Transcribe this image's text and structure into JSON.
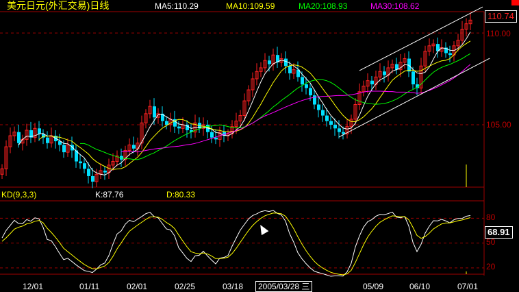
{
  "header": {
    "title": "美元日元(外汇交易)日线",
    "ma5": "MA5:110.29",
    "ma10": "MA10:109.59",
    "ma20": "MA20:108.93",
    "ma30": "MA30:108.62"
  },
  "indicator_header": {
    "name": "KD(9,3,3)",
    "k": "K:87.76",
    "d": "D:80.33"
  },
  "price_axis": {
    "labels": [
      "110.00",
      "105.00"
    ],
    "current": "110.74"
  },
  "kd_axis": {
    "labels": [
      "80",
      "50",
      "20"
    ],
    "current": "68.91"
  },
  "date_axis": {
    "labels": [
      "12/01",
      "01/11",
      "02/01",
      "02/25",
      "03/18",
      "05/09",
      "06/10",
      "07/01"
    ],
    "cursor_date": "2005/03/28 三"
  },
  "colors": {
    "up": "#ff2020",
    "down": "#00e0ff",
    "ma5": "#ffffff",
    "ma10": "#ffff00",
    "ma20": "#00ff00",
    "ma30": "#ff00ff",
    "grid": "#a00000"
  },
  "chart_data": {
    "type": "candlestick",
    "title": "美元日元(外汇交易)日线",
    "ylim": [
      101.6,
      111.16
    ],
    "close": [
      102.6,
      103.8,
      104.4,
      104.6,
      104.0,
      104.2,
      104.7,
      104.3,
      104.8,
      104.5,
      104.3,
      104.0,
      104.4,
      104.1,
      103.9,
      103.5,
      103.9,
      103.6,
      103.0,
      102.9,
      102.6,
      102.2,
      101.9,
      102.3,
      102.5,
      102.4,
      102.8,
      103.0,
      103.3,
      103.1,
      103.6,
      103.9,
      103.7,
      104.0,
      105.1,
      105.6,
      106.0,
      105.4,
      105.6,
      105.2,
      105.0,
      105.3,
      104.9,
      104.8,
      105.0,
      104.7,
      104.6,
      105.1,
      104.8,
      105.0,
      104.6,
      104.3,
      104.2,
      104.6,
      104.4,
      104.5,
      104.9,
      105.2,
      105.5,
      106.3,
      106.9,
      107.5,
      107.9,
      108.1,
      108.5,
      108.3,
      108.8,
      108.4,
      108.6,
      108.2,
      107.8,
      108.0,
      107.6,
      107.2,
      107.0,
      106.6,
      106.1,
      105.8,
      105.5,
      105.2,
      105.0,
      104.8,
      104.6,
      104.5,
      104.9,
      105.3,
      106.1,
      106.8,
      107.1,
      107.4,
      107.2,
      107.6,
      107.9,
      107.7,
      108.1,
      108.3,
      108.0,
      108.4,
      108.6,
      107.9,
      107.2,
      107.0,
      108.2,
      109.0,
      109.3,
      109.4,
      109.0,
      109.2,
      108.9,
      108.8,
      109.3,
      109.6,
      110.2,
      110.5,
      110.7
    ],
    "moving_averages": [
      5,
      10,
      20,
      30
    ],
    "channel_lines": [
      {
        "from": [
          87,
          107.95
        ],
        "to": [
          117,
          111.42
        ]
      },
      {
        "from": [
          82,
          104.33
        ],
        "to": [
          118.7,
          108.62
        ]
      }
    ],
    "kd_params": [
      9,
      3,
      3
    ],
    "kd_ylim": [
      12.5,
      101
    ],
    "cursor_bar": 113
  }
}
